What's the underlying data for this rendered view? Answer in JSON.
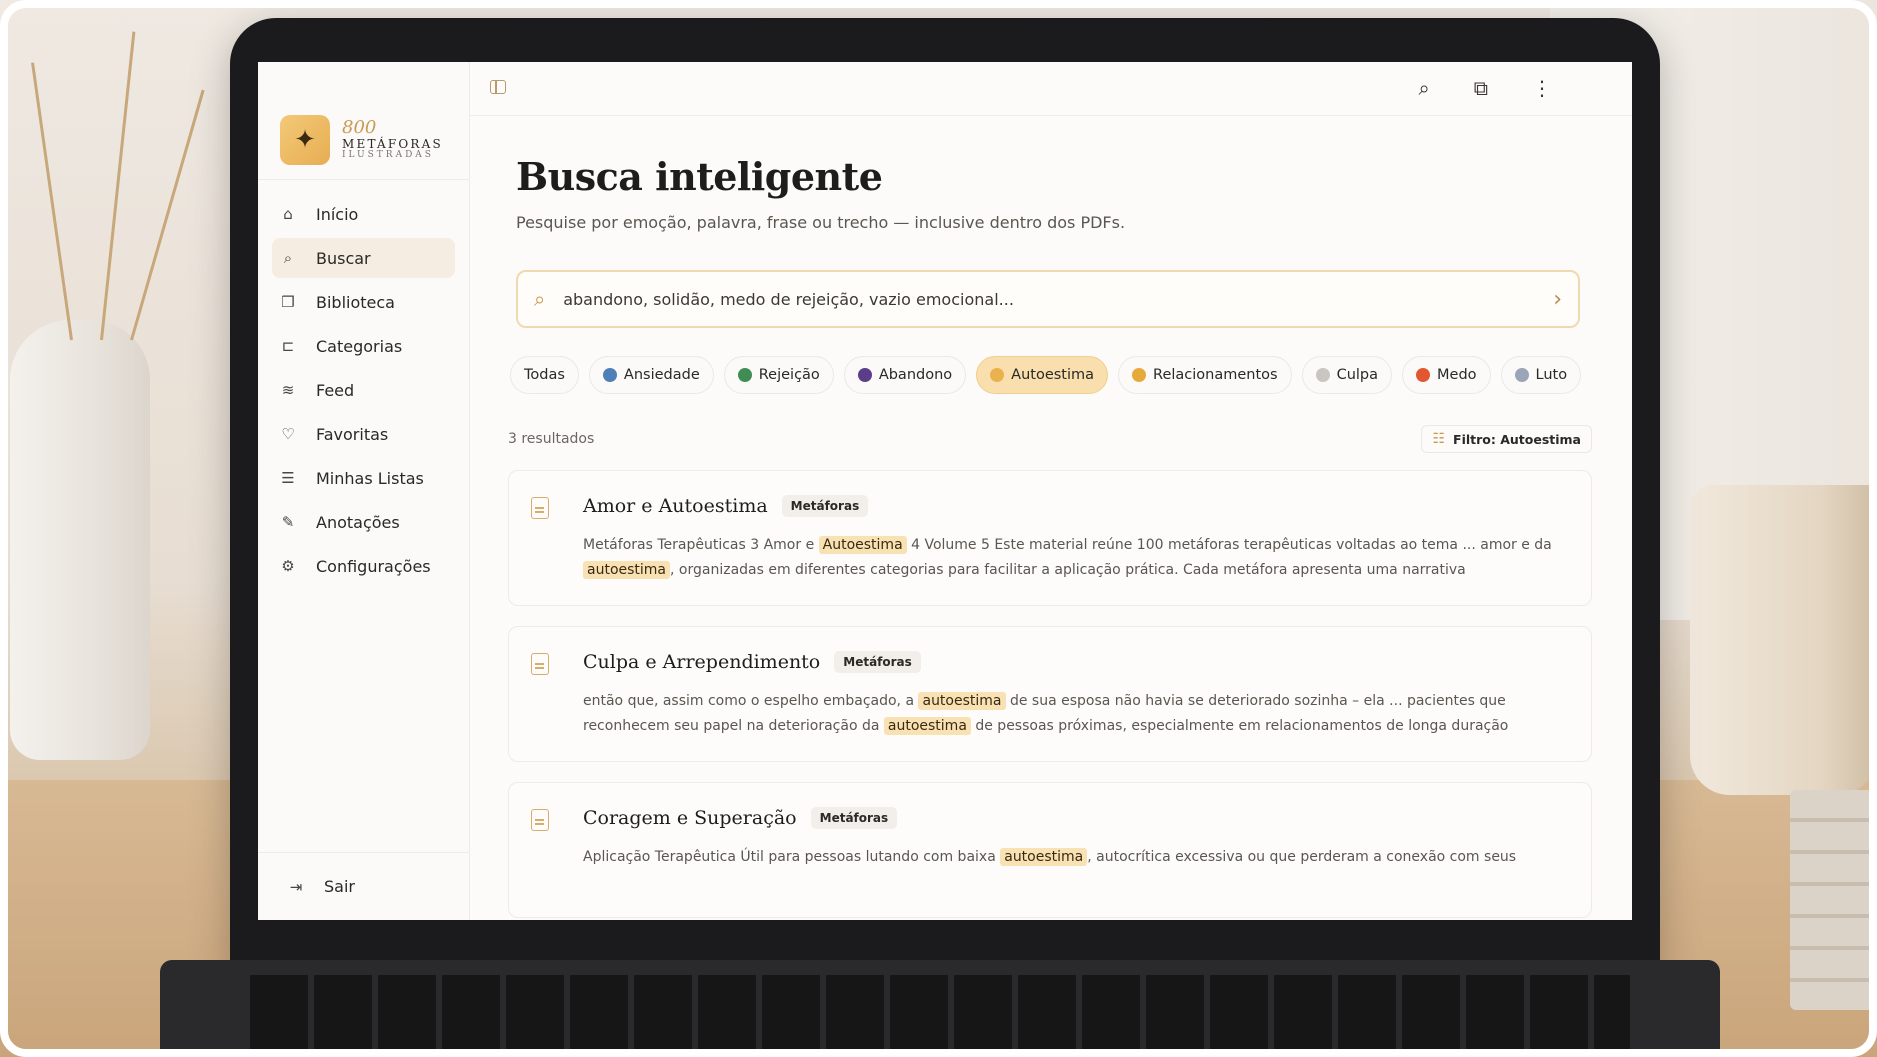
{
  "brand": {
    "number": "800",
    "name": "METÁFORAS",
    "sub": "ILUSTRADAS"
  },
  "sidebar": {
    "items": [
      {
        "label": "Início",
        "icon": "home-icon",
        "glyph": "⌂"
      },
      {
        "label": "Buscar",
        "icon": "search-icon",
        "glyph": "⌕"
      },
      {
        "label": "Biblioteca",
        "icon": "book-icon",
        "glyph": "❒"
      },
      {
        "label": "Categorias",
        "icon": "categories-icon",
        "glyph": "⊏"
      },
      {
        "label": "Feed",
        "icon": "rss-icon",
        "glyph": "≋"
      },
      {
        "label": "Favoritas",
        "icon": "heart-icon",
        "glyph": "♡"
      },
      {
        "label": "Minhas Listas",
        "icon": "list-icon",
        "glyph": "☰"
      },
      {
        "label": "Anotações",
        "icon": "edit-icon",
        "glyph": "✎"
      },
      {
        "label": "Configurações",
        "icon": "gear-icon",
        "glyph": "⚙"
      }
    ],
    "active_index": 1,
    "logout_label": "Sair"
  },
  "main": {
    "title": "Busca inteligente",
    "subtitle": "Pesquise por emoção, palavra, frase ou trecho — inclusive dentro dos PDFs.",
    "search": {
      "value": "abandono, solidão, medo de rejeição, vazio emocional..."
    },
    "chips": [
      {
        "label": "Todas",
        "color": ""
      },
      {
        "label": "Ansiedade",
        "color": "#4f7fb8"
      },
      {
        "label": "Rejeição",
        "color": "#3f8c55"
      },
      {
        "label": "Abandono",
        "color": "#5a3e8a"
      },
      {
        "label": "Autoestima",
        "color": "#e9b24c"
      },
      {
        "label": "Relacionamentos",
        "color": "#e7a93a"
      },
      {
        "label": "Culpa",
        "color": "#c9c6c2"
      },
      {
        "label": "Medo",
        "color": "#e2572f"
      },
      {
        "label": "Luto",
        "color": "#9aa6b8"
      }
    ],
    "active_chip_index": 4,
    "results_count": "3 resultados",
    "filter_label": "Filtro: Autoestima",
    "results": [
      {
        "title": "Amor e Autoestima",
        "tag": "Metáforas",
        "excerpt": [
          {
            "t": "Metáforas Terapêuticas 3 Amor e ",
            "h": false
          },
          {
            "t": "Autoestima",
            "h": true
          },
          {
            "t": " 4 Volume 5 Este material reúne 100 metáforas terapêuticas voltadas ao tema ... amor e da ",
            "h": false
          },
          {
            "t": "autoestima",
            "h": true
          },
          {
            "t": ", organizadas em diferentes categorias para facilitar a aplicação prática. Cada metáfora apresenta uma narrativa",
            "h": false
          }
        ]
      },
      {
        "title": "Culpa e Arrependimento",
        "tag": "Metáforas",
        "excerpt": [
          {
            "t": "então que, assim como o espelho embaçado, a ",
            "h": false
          },
          {
            "t": "autoestima",
            "h": true
          },
          {
            "t": " de sua esposa não havia se deteriorado sozinha – ela ... pacientes que reconhecem seu papel na deterioração da ",
            "h": false
          },
          {
            "t": "autoestima",
            "h": true
          },
          {
            "t": " de pessoas próximas, especialmente em relacionamentos de longa duração",
            "h": false
          }
        ]
      },
      {
        "title": "Coragem e Superação",
        "tag": "Metáforas",
        "excerpt": [
          {
            "t": "Aplicação Terapêutica Útil para pessoas lutando com baixa ",
            "h": false
          },
          {
            "t": "autoestima",
            "h": true
          },
          {
            "t": ", autocrítica excessiva ou que perderam a conexão com seus",
            "h": false
          }
        ]
      }
    ]
  }
}
